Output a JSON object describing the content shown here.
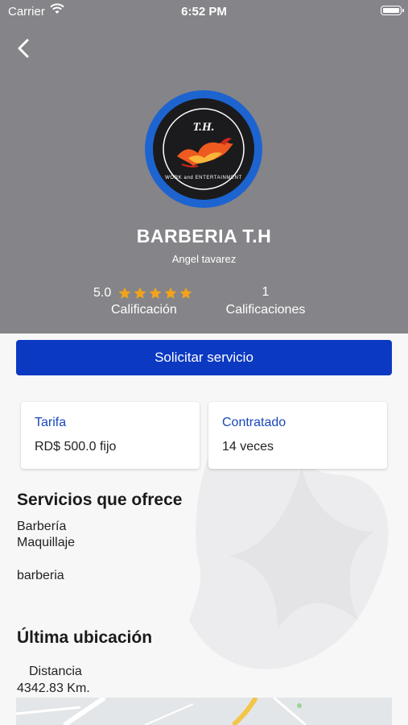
{
  "status_bar": {
    "carrier": "Carrier",
    "time": "6:52 PM"
  },
  "profile": {
    "logo_text": "T.H.",
    "logo_ring_text": "WORK and ENTERTAINMENT",
    "name": "BARBERIA T.H",
    "owner": "Angel tavarez",
    "rating": {
      "value": "5.0",
      "stars": 5,
      "label": "Calificación"
    },
    "ratings_count": {
      "value": "1",
      "label": "Calificaciones"
    }
  },
  "colors": {
    "header": "#858489",
    "primary": "#0b39c2",
    "accent_text": "#1947b8",
    "star": "#f2a31b",
    "logo_ring": "#1d64d0"
  },
  "actions": {
    "request_service": "Solicitar servicio"
  },
  "cards": {
    "rate": {
      "title": "Tarifa",
      "value": "RD$ 500.0 fijo"
    },
    "hired": {
      "title": "Contratado",
      "value": "14 veces"
    }
  },
  "services": {
    "title": "Servicios que ofrece",
    "items": [
      "Barbería",
      "Maquillaje"
    ],
    "description": "barberia"
  },
  "location": {
    "title": "Última ubicación",
    "distance_label": "Distancia",
    "distance_value": "4342.83 Km."
  }
}
